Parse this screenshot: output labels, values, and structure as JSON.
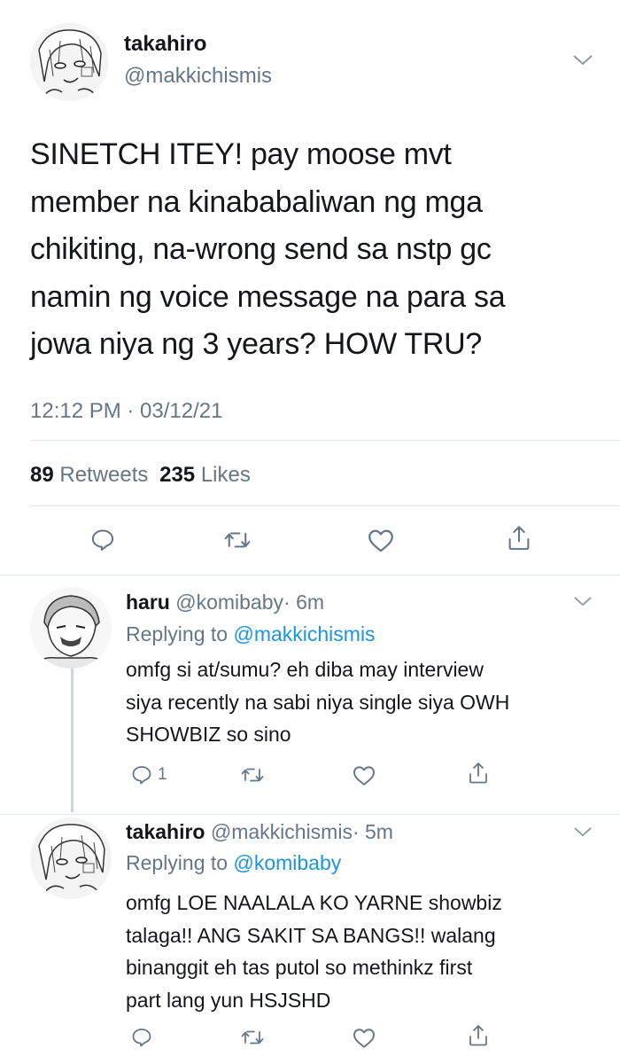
{
  "main_tweet": {
    "display_name": "takahiro",
    "handle": "@makkichismis",
    "text_lines": [
      "SINETCH ITEY! pay moose mvt",
      "member na kinababaliwan ng mga",
      "chikiting, na-wrong send sa nstp gc",
      "namin ng voice message na para sa",
      "jowa niya ng 3 years? HOW TRU?"
    ],
    "timestamp": "12:12 PM · 03/12/21",
    "retweets_count": "89",
    "retweets_label": "Retweets",
    "likes_count": "235",
    "likes_label": "Likes",
    "actions": [
      "reply-icon",
      "retweet-icon",
      "like-icon",
      "share-icon"
    ]
  },
  "replies": [
    {
      "display_name": "haru",
      "handle": "@komibaby",
      "time": "· 6m",
      "replying_prefix": "Replying to",
      "replying_to": "@makkichismis",
      "text_lines": [
        "omfg si at/sumu? eh diba may interview",
        "siya recently na sabi niya single siya OWH",
        "SHOWBIZ so sino"
      ],
      "reply_count": "1"
    },
    {
      "display_name": "takahiro",
      "handle": "@makkichismis",
      "time": "· 5m",
      "replying_prefix": "Replying to",
      "replying_to": "@komibaby",
      "text_lines": [
        "omfg LOE NAALALA KO YARNE showbiz",
        "talaga!! ANG SAKIT SA BANGS!! walang",
        "binanggit eh tas putol so methinkz first",
        "part lang yun HSJSHD"
      ],
      "reply_count": ""
    }
  ],
  "colors": {
    "text": "#14171a",
    "secondary": "#657786",
    "link": "#1b95e0",
    "divider": "#e1e8ed",
    "icon": "#657786"
  }
}
